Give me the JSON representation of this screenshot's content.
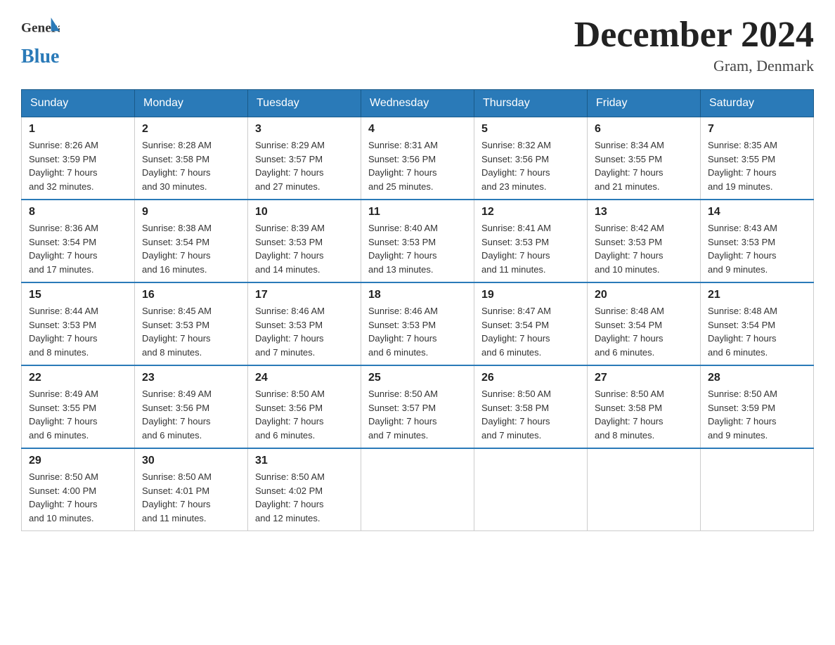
{
  "header": {
    "title": "December 2024",
    "subtitle": "Gram, Denmark"
  },
  "logo": {
    "general": "General",
    "blue": "Blue"
  },
  "days_of_week": [
    "Sunday",
    "Monday",
    "Tuesday",
    "Wednesday",
    "Thursday",
    "Friday",
    "Saturday"
  ],
  "weeks": [
    [
      {
        "day": "1",
        "sunrise": "8:26 AM",
        "sunset": "3:59 PM",
        "daylight": "7 hours and 32 minutes."
      },
      {
        "day": "2",
        "sunrise": "8:28 AM",
        "sunset": "3:58 PM",
        "daylight": "7 hours and 30 minutes."
      },
      {
        "day": "3",
        "sunrise": "8:29 AM",
        "sunset": "3:57 PM",
        "daylight": "7 hours and 27 minutes."
      },
      {
        "day": "4",
        "sunrise": "8:31 AM",
        "sunset": "3:56 PM",
        "daylight": "7 hours and 25 minutes."
      },
      {
        "day": "5",
        "sunrise": "8:32 AM",
        "sunset": "3:56 PM",
        "daylight": "7 hours and 23 minutes."
      },
      {
        "day": "6",
        "sunrise": "8:34 AM",
        "sunset": "3:55 PM",
        "daylight": "7 hours and 21 minutes."
      },
      {
        "day": "7",
        "sunrise": "8:35 AM",
        "sunset": "3:55 PM",
        "daylight": "7 hours and 19 minutes."
      }
    ],
    [
      {
        "day": "8",
        "sunrise": "8:36 AM",
        "sunset": "3:54 PM",
        "daylight": "7 hours and 17 minutes."
      },
      {
        "day": "9",
        "sunrise": "8:38 AM",
        "sunset": "3:54 PM",
        "daylight": "7 hours and 16 minutes."
      },
      {
        "day": "10",
        "sunrise": "8:39 AM",
        "sunset": "3:53 PM",
        "daylight": "7 hours and 14 minutes."
      },
      {
        "day": "11",
        "sunrise": "8:40 AM",
        "sunset": "3:53 PM",
        "daylight": "7 hours and 13 minutes."
      },
      {
        "day": "12",
        "sunrise": "8:41 AM",
        "sunset": "3:53 PM",
        "daylight": "7 hours and 11 minutes."
      },
      {
        "day": "13",
        "sunrise": "8:42 AM",
        "sunset": "3:53 PM",
        "daylight": "7 hours and 10 minutes."
      },
      {
        "day": "14",
        "sunrise": "8:43 AM",
        "sunset": "3:53 PM",
        "daylight": "7 hours and 9 minutes."
      }
    ],
    [
      {
        "day": "15",
        "sunrise": "8:44 AM",
        "sunset": "3:53 PM",
        "daylight": "7 hours and 8 minutes."
      },
      {
        "day": "16",
        "sunrise": "8:45 AM",
        "sunset": "3:53 PM",
        "daylight": "7 hours and 8 minutes."
      },
      {
        "day": "17",
        "sunrise": "8:46 AM",
        "sunset": "3:53 PM",
        "daylight": "7 hours and 7 minutes."
      },
      {
        "day": "18",
        "sunrise": "8:46 AM",
        "sunset": "3:53 PM",
        "daylight": "7 hours and 6 minutes."
      },
      {
        "day": "19",
        "sunrise": "8:47 AM",
        "sunset": "3:54 PM",
        "daylight": "7 hours and 6 minutes."
      },
      {
        "day": "20",
        "sunrise": "8:48 AM",
        "sunset": "3:54 PM",
        "daylight": "7 hours and 6 minutes."
      },
      {
        "day": "21",
        "sunrise": "8:48 AM",
        "sunset": "3:54 PM",
        "daylight": "7 hours and 6 minutes."
      }
    ],
    [
      {
        "day": "22",
        "sunrise": "8:49 AM",
        "sunset": "3:55 PM",
        "daylight": "7 hours and 6 minutes."
      },
      {
        "day": "23",
        "sunrise": "8:49 AM",
        "sunset": "3:56 PM",
        "daylight": "7 hours and 6 minutes."
      },
      {
        "day": "24",
        "sunrise": "8:50 AM",
        "sunset": "3:56 PM",
        "daylight": "7 hours and 6 minutes."
      },
      {
        "day": "25",
        "sunrise": "8:50 AM",
        "sunset": "3:57 PM",
        "daylight": "7 hours and 7 minutes."
      },
      {
        "day": "26",
        "sunrise": "8:50 AM",
        "sunset": "3:58 PM",
        "daylight": "7 hours and 7 minutes."
      },
      {
        "day": "27",
        "sunrise": "8:50 AM",
        "sunset": "3:58 PM",
        "daylight": "7 hours and 8 minutes."
      },
      {
        "day": "28",
        "sunrise": "8:50 AM",
        "sunset": "3:59 PM",
        "daylight": "7 hours and 9 minutes."
      }
    ],
    [
      {
        "day": "29",
        "sunrise": "8:50 AM",
        "sunset": "4:00 PM",
        "daylight": "7 hours and 10 minutes."
      },
      {
        "day": "30",
        "sunrise": "8:50 AM",
        "sunset": "4:01 PM",
        "daylight": "7 hours and 11 minutes."
      },
      {
        "day": "31",
        "sunrise": "8:50 AM",
        "sunset": "4:02 PM",
        "daylight": "7 hours and 12 minutes."
      },
      null,
      null,
      null,
      null
    ]
  ],
  "labels": {
    "sunrise": "Sunrise:",
    "sunset": "Sunset:",
    "daylight": "Daylight:"
  }
}
